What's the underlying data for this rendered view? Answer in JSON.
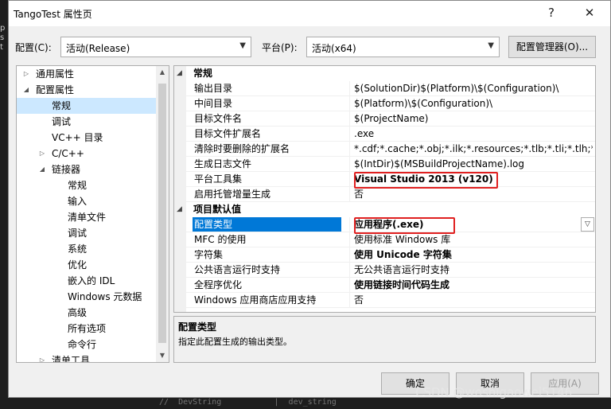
{
  "background": {
    "side_text": "p\ns\nt",
    "code_line": "//  DevString           |  dev_string"
  },
  "window": {
    "title": "TangoTest 属性页",
    "help_icon": "?",
    "close_icon": "✕"
  },
  "toolbar": {
    "config_label": "配置(C):",
    "config_value": "活动(Release)",
    "platform_label": "平台(P):",
    "platform_value": "活动(x64)",
    "manager_button": "配置管理器(O)..."
  },
  "tree": {
    "items": [
      {
        "label": "通用属性",
        "expander": "▷"
      },
      {
        "label": "配置属性",
        "expander": "◢"
      },
      {
        "label": "常规",
        "expander": ""
      },
      {
        "label": "调试",
        "expander": ""
      },
      {
        "label": "VC++ 目录",
        "expander": ""
      },
      {
        "label": "C/C++",
        "expander": "▷"
      },
      {
        "label": "链接器",
        "expander": "◢"
      },
      {
        "label": "常规",
        "expander": ""
      },
      {
        "label": "输入",
        "expander": ""
      },
      {
        "label": "清单文件",
        "expander": ""
      },
      {
        "label": "调试",
        "expander": ""
      },
      {
        "label": "系统",
        "expander": ""
      },
      {
        "label": "优化",
        "expander": ""
      },
      {
        "label": "嵌入的 IDL",
        "expander": ""
      },
      {
        "label": "Windows 元数据",
        "expander": ""
      },
      {
        "label": "高级",
        "expander": ""
      },
      {
        "label": "所有选项",
        "expander": ""
      },
      {
        "label": "命令行",
        "expander": ""
      },
      {
        "label": "清单工具",
        "expander": "▷"
      }
    ],
    "selected_index": 2
  },
  "grid": {
    "category_general": "常规",
    "category_defaults": "项目默认值",
    "general_rows": [
      {
        "key": "输出目录",
        "value": "$(SolutionDir)$(Platform)\\$(Configuration)\\"
      },
      {
        "key": "中间目录",
        "value": "$(Platform)\\$(Configuration)\\"
      },
      {
        "key": "目标文件名",
        "value": "$(ProjectName)"
      },
      {
        "key": "目标文件扩展名",
        "value": ".exe"
      },
      {
        "key": "清除时要删除的扩展名",
        "value": "*.cdf;*.cache;*.obj;*.ilk;*.resources;*.tlb;*.tli;*.tlh;*.tmp;*"
      },
      {
        "key": "生成日志文件",
        "value": "$(IntDir)$(MSBuildProjectName).log"
      },
      {
        "key": "平台工具集",
        "value": "Visual Studio 2013 (v120)"
      },
      {
        "key": "启用托管增量生成",
        "value": "否"
      }
    ],
    "defaults_rows": [
      {
        "key": "配置类型",
        "value": "应用程序(.exe)"
      },
      {
        "key": "MFC 的使用",
        "value": "使用标准 Windows 库"
      },
      {
        "key": "字符集",
        "value": "使用 Unicode 字符集"
      },
      {
        "key": "公共语言运行时支持",
        "value": "无公共语言运行时支持"
      },
      {
        "key": "全程序优化",
        "value": "使用链接时间代码生成"
      },
      {
        "key": "Windows 应用商店应用支持",
        "value": "否"
      }
    ]
  },
  "description": {
    "title": "配置类型",
    "text": "指定此配置生成的输出类型。"
  },
  "buttons": {
    "ok": "确定",
    "cancel": "取消",
    "apply": "应用(A)"
  },
  "watermark": "CSDN @woshigaowei5146",
  "colors": {
    "selection": "#0078d7",
    "highlight_box": "#e02020",
    "tree_selection": "#cce8ff"
  }
}
